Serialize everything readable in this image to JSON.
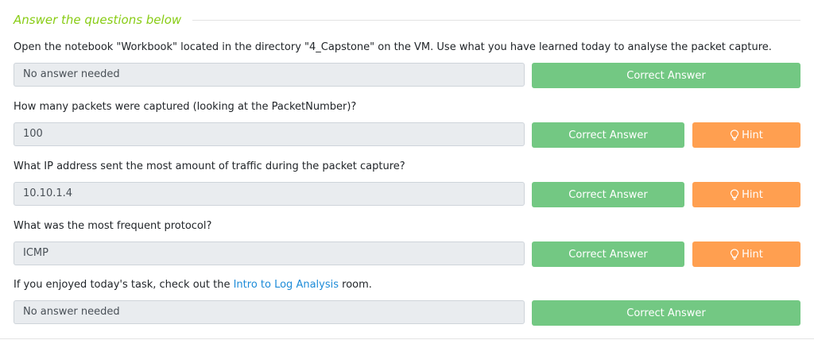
{
  "section": {
    "title": "Answer the questions below"
  },
  "questions": [
    {
      "text": "Open the notebook \"Workbook\" located in the directory \"4_Capstone\" on the VM. Use what you have learned today to analyse the packet capture.",
      "answer": "No answer needed",
      "submit_label": "Correct Answer"
    },
    {
      "text": "How many packets were captured (looking at the PacketNumber)?",
      "answer": "100",
      "submit_label": "Correct Answer",
      "hint_label": "Hint"
    },
    {
      "text": "What IP address sent the most amount of traffic during the packet capture?",
      "answer": "10.10.1.4",
      "submit_label": "Correct Answer",
      "hint_label": "Hint"
    },
    {
      "text": "What was the most frequent protocol?",
      "answer": "ICMP",
      "submit_label": "Correct Answer",
      "hint_label": "Hint"
    },
    {
      "text_before": "If you enjoyed today's task, check out the ",
      "link_text": "Intro to Log Analysis",
      "text_after": " room.",
      "answer": "No answer needed",
      "submit_label": "Correct Answer"
    }
  ],
  "icons": {
    "hint": "lightbulb-icon"
  },
  "colors": {
    "title": "#88cc14",
    "correct": "#73c883",
    "hint": "#ff9f50",
    "link": "#1c8bd8"
  }
}
